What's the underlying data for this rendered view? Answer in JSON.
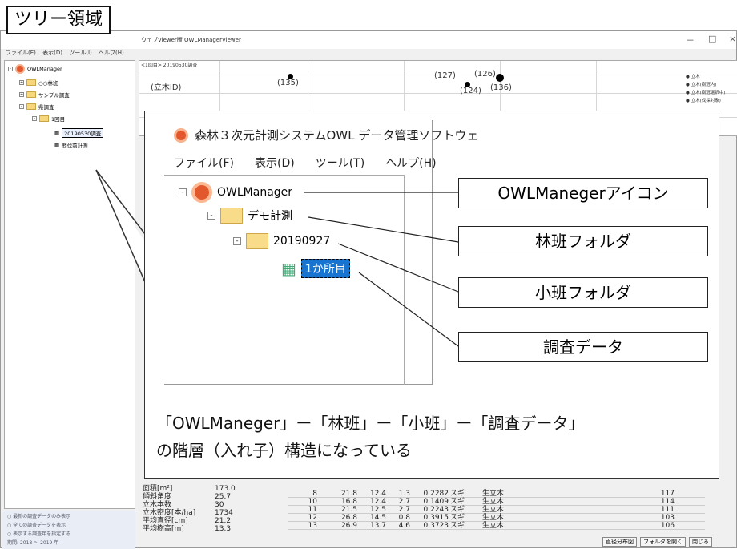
{
  "app": {
    "window_title": "ウェブViewer版 OWLManagerViewer",
    "controls": [
      "－",
      "□",
      "×"
    ],
    "menu": [
      "ファイル(E)",
      "表示(D)",
      "ツール(I)",
      "ヘルプ(H)"
    ]
  },
  "tree": {
    "root": "OWLManager",
    "items": [
      {
        "label": "○○林班"
      },
      {
        "label": "サンプル調査"
      },
      {
        "label": "県調査"
      },
      {
        "label": "1回目"
      },
      {
        "label": "20190530調査"
      },
      {
        "label": "間伐前計測"
      }
    ]
  },
  "bottom_left": {
    "options": [
      "最新の調査データのみ表示",
      "全ての調査データを表示",
      "表示する調査年を指定する"
    ],
    "period_label": "期間:",
    "year_from": "2018",
    "tilde": "～",
    "year_to": "2019",
    "year_unit": "年"
  },
  "chart": {
    "tab": "<1回目> 20190530調査",
    "ylabel": "(立木ID)",
    "points": [
      "(135)",
      "(127)",
      "(126)",
      "(124)",
      "(136)"
    ],
    "legend": [
      "立木",
      "立木(樹冠内)",
      "立木(樹冠選択中)",
      "立木(伐採対象)"
    ]
  },
  "info": {
    "rows": [
      {
        "k": "面積[m²]",
        "v": "173.0"
      },
      {
        "k": "傾斜角度",
        "v": "25.7"
      },
      {
        "k": "立木本数",
        "v": "30"
      },
      {
        "k": "立木密度[本/ha]",
        "v": "1734"
      },
      {
        "k": "平均直径[cm]",
        "v": "21.2"
      },
      {
        "k": "平均樹高[m]",
        "v": "13.3"
      }
    ]
  },
  "table": {
    "rows": [
      [
        "8",
        "21.8",
        "12.4",
        "1.3",
        "0.2282",
        "スギ",
        "生立木",
        "117"
      ],
      [
        "10",
        "16.8",
        "12.4",
        "2.7",
        "0.1409",
        "スギ",
        "生立木",
        "114"
      ],
      [
        "11",
        "21.5",
        "12.5",
        "2.7",
        "0.2243",
        "スギ",
        "生立木",
        "111"
      ],
      [
        "12",
        "26.8",
        "14.5",
        "0.8",
        "0.3915",
        "スギ",
        "生立木",
        "103"
      ],
      [
        "13",
        "26.9",
        "13.7",
        "4.6",
        "0.3723",
        "スギ",
        "生立木",
        "106"
      ]
    ]
  },
  "bottom_buttons": [
    "直径分布図",
    "フォルダを開く",
    "閉じる"
  ],
  "callout": {
    "title": "森林３次元計測システムOWL データ管理ソフトウェ",
    "menu": [
      "ファイル(F)",
      "表示(D)",
      "ツール(T)",
      "ヘルプ(H)"
    ],
    "nodes": [
      "OWLManager",
      "デモ計測",
      "20190927",
      "1か所目"
    ],
    "labels": [
      "OWLManegerアイコン",
      "林班フォルダ",
      "小班フォルダ",
      "調査データ"
    ],
    "note_line1": "「OWLManeger」ー「林班」ー「小班」ー「調査データ」",
    "note_line2": "の階層（入れ子）構造になっている"
  },
  "tag_label": "ツリー領域"
}
